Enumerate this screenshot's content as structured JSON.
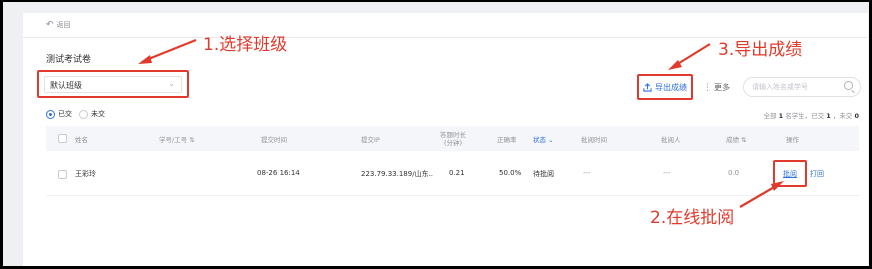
{
  "nav": {
    "back_label": "返回"
  },
  "exam": {
    "title": "测试考试卷"
  },
  "class_select": {
    "value": "默认班级"
  },
  "filters": {
    "submitted": "已交",
    "not_submitted": "未交"
  },
  "toolbar": {
    "export_label": "导出成绩",
    "more_label": "更多",
    "search_placeholder": "请输入姓名或学号"
  },
  "summary": {
    "prefix": "全部",
    "total": "1",
    "mid": "名学生，已交",
    "submitted": "1",
    "mid2": "，未交",
    "not_submitted": "0"
  },
  "table": {
    "headers": {
      "name": "姓名",
      "student_id": "学号/工号 ⇅",
      "submit_time": "提交时间",
      "submit_ip": "提交IP",
      "duration_line1": "答题时长",
      "duration_line2": "(分钟)",
      "accuracy": "正确率",
      "status": "状态 ⌄",
      "review_time": "批阅时间",
      "reviewer": "批阅人",
      "score": "成绩 ⇅",
      "actions": "操作"
    },
    "rows": [
      {
        "name": "王彩玲",
        "submit_time": "08-26 16:14",
        "submit_ip": "223.79.33.189/山东..",
        "duration": "0.21",
        "accuracy": "50.0%",
        "status": "待批阅",
        "review_time": "---",
        "reviewer": "---",
        "score": "0.0",
        "approve_label": "批阅",
        "print_label": "打回"
      }
    ]
  },
  "annotations": {
    "step1": "1.选择班级",
    "step2": "2.在线批阅",
    "step3": "3.导出成绩",
    "color": "#e03a2c"
  }
}
